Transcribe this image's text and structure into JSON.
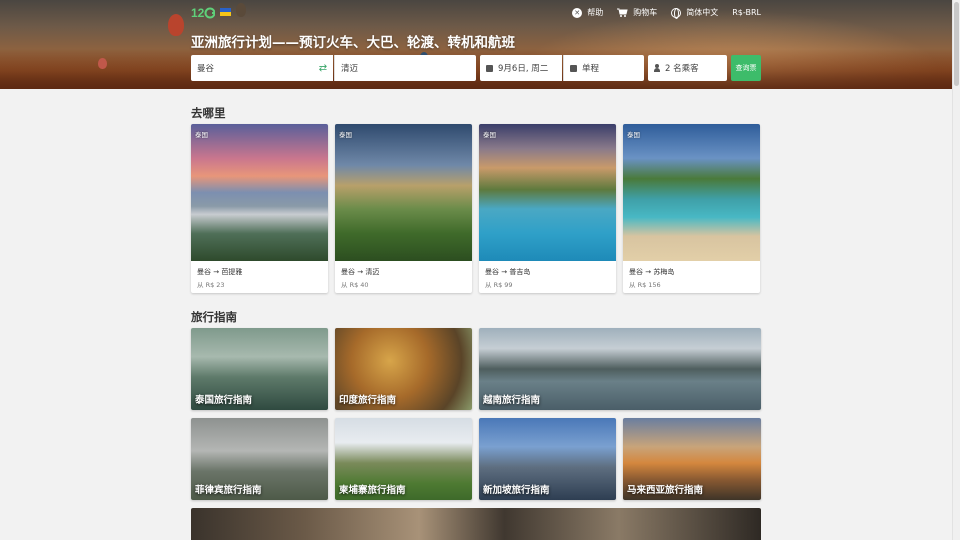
{
  "header": {
    "logo": "12Go",
    "nav": [
      {
        "label": "帮助",
        "icon": "help-icon"
      },
      {
        "label": "购物车",
        "icon": "cart-icon"
      },
      {
        "label": "简体中文",
        "icon": "globe-icon"
      },
      {
        "label": "R$-BRL",
        "icon": ""
      }
    ],
    "title": "亚洲旅行计划——预订火车、大巴、轮渡、转机和航班"
  },
  "search": {
    "from": "曼谷",
    "to": "清迈",
    "date": "9月6日, 周二",
    "trip_type": "单程",
    "passengers": "2 名乘客",
    "button": "查询票"
  },
  "destinations": {
    "title": "去哪里",
    "items": [
      {
        "country": "泰国",
        "route": "曼谷 → 芭提雅",
        "price": "从 R$ 23"
      },
      {
        "country": "泰国",
        "route": "曼谷 → 清迈",
        "price": "从 R$ 40"
      },
      {
        "country": "泰国",
        "route": "曼谷 → 普吉岛",
        "price": "从 R$ 99"
      },
      {
        "country": "泰国",
        "route": "曼谷 → 苏梅岛",
        "price": "从 R$ 156"
      }
    ]
  },
  "guides": {
    "title": "旅行指南",
    "items": [
      {
        "label": "泰国旅行指南"
      },
      {
        "label": "印度旅行指南"
      },
      {
        "label": "越南旅行指南"
      },
      {
        "label": "菲律宾旅行指南"
      },
      {
        "label": "柬埔寨旅行指南"
      },
      {
        "label": "新加坡旅行指南"
      },
      {
        "label": "马来西亚旅行指南"
      }
    ]
  },
  "colors": {
    "accent": "#3dbc6a",
    "swap": "#3aa66a"
  }
}
